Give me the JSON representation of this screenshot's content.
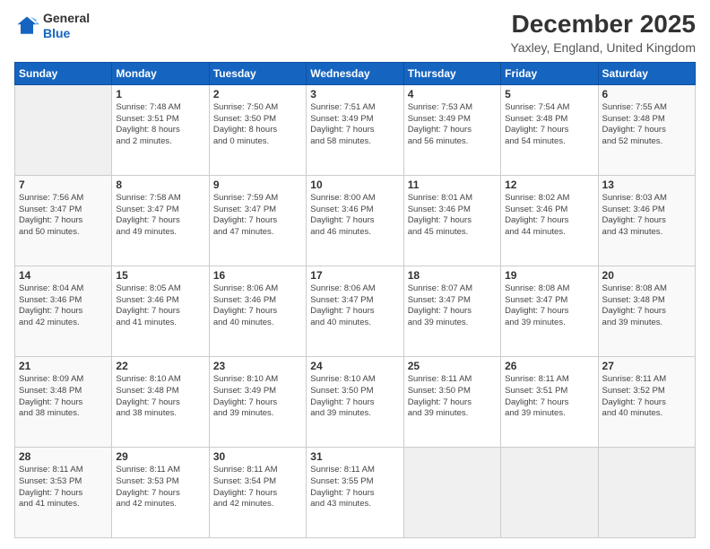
{
  "header": {
    "logo_line1": "General",
    "logo_line2": "Blue",
    "main_title": "December 2025",
    "subtitle": "Yaxley, England, United Kingdom"
  },
  "days_of_week": [
    "Sunday",
    "Monday",
    "Tuesday",
    "Wednesday",
    "Thursday",
    "Friday",
    "Saturday"
  ],
  "weeks": [
    [
      {
        "day": "",
        "info": ""
      },
      {
        "day": "1",
        "info": "Sunrise: 7:48 AM\nSunset: 3:51 PM\nDaylight: 8 hours\nand 2 minutes."
      },
      {
        "day": "2",
        "info": "Sunrise: 7:50 AM\nSunset: 3:50 PM\nDaylight: 8 hours\nand 0 minutes."
      },
      {
        "day": "3",
        "info": "Sunrise: 7:51 AM\nSunset: 3:49 PM\nDaylight: 7 hours\nand 58 minutes."
      },
      {
        "day": "4",
        "info": "Sunrise: 7:53 AM\nSunset: 3:49 PM\nDaylight: 7 hours\nand 56 minutes."
      },
      {
        "day": "5",
        "info": "Sunrise: 7:54 AM\nSunset: 3:48 PM\nDaylight: 7 hours\nand 54 minutes."
      },
      {
        "day": "6",
        "info": "Sunrise: 7:55 AM\nSunset: 3:48 PM\nDaylight: 7 hours\nand 52 minutes."
      }
    ],
    [
      {
        "day": "7",
        "info": "Sunrise: 7:56 AM\nSunset: 3:47 PM\nDaylight: 7 hours\nand 50 minutes."
      },
      {
        "day": "8",
        "info": "Sunrise: 7:58 AM\nSunset: 3:47 PM\nDaylight: 7 hours\nand 49 minutes."
      },
      {
        "day": "9",
        "info": "Sunrise: 7:59 AM\nSunset: 3:47 PM\nDaylight: 7 hours\nand 47 minutes."
      },
      {
        "day": "10",
        "info": "Sunrise: 8:00 AM\nSunset: 3:46 PM\nDaylight: 7 hours\nand 46 minutes."
      },
      {
        "day": "11",
        "info": "Sunrise: 8:01 AM\nSunset: 3:46 PM\nDaylight: 7 hours\nand 45 minutes."
      },
      {
        "day": "12",
        "info": "Sunrise: 8:02 AM\nSunset: 3:46 PM\nDaylight: 7 hours\nand 44 minutes."
      },
      {
        "day": "13",
        "info": "Sunrise: 8:03 AM\nSunset: 3:46 PM\nDaylight: 7 hours\nand 43 minutes."
      }
    ],
    [
      {
        "day": "14",
        "info": "Sunrise: 8:04 AM\nSunset: 3:46 PM\nDaylight: 7 hours\nand 42 minutes."
      },
      {
        "day": "15",
        "info": "Sunrise: 8:05 AM\nSunset: 3:46 PM\nDaylight: 7 hours\nand 41 minutes."
      },
      {
        "day": "16",
        "info": "Sunrise: 8:06 AM\nSunset: 3:46 PM\nDaylight: 7 hours\nand 40 minutes."
      },
      {
        "day": "17",
        "info": "Sunrise: 8:06 AM\nSunset: 3:47 PM\nDaylight: 7 hours\nand 40 minutes."
      },
      {
        "day": "18",
        "info": "Sunrise: 8:07 AM\nSunset: 3:47 PM\nDaylight: 7 hours\nand 39 minutes."
      },
      {
        "day": "19",
        "info": "Sunrise: 8:08 AM\nSunset: 3:47 PM\nDaylight: 7 hours\nand 39 minutes."
      },
      {
        "day": "20",
        "info": "Sunrise: 8:08 AM\nSunset: 3:48 PM\nDaylight: 7 hours\nand 39 minutes."
      }
    ],
    [
      {
        "day": "21",
        "info": "Sunrise: 8:09 AM\nSunset: 3:48 PM\nDaylight: 7 hours\nand 38 minutes."
      },
      {
        "day": "22",
        "info": "Sunrise: 8:10 AM\nSunset: 3:48 PM\nDaylight: 7 hours\nand 38 minutes."
      },
      {
        "day": "23",
        "info": "Sunrise: 8:10 AM\nSunset: 3:49 PM\nDaylight: 7 hours\nand 39 minutes."
      },
      {
        "day": "24",
        "info": "Sunrise: 8:10 AM\nSunset: 3:50 PM\nDaylight: 7 hours\nand 39 minutes."
      },
      {
        "day": "25",
        "info": "Sunrise: 8:11 AM\nSunset: 3:50 PM\nDaylight: 7 hours\nand 39 minutes."
      },
      {
        "day": "26",
        "info": "Sunrise: 8:11 AM\nSunset: 3:51 PM\nDaylight: 7 hours\nand 39 minutes."
      },
      {
        "day": "27",
        "info": "Sunrise: 8:11 AM\nSunset: 3:52 PM\nDaylight: 7 hours\nand 40 minutes."
      }
    ],
    [
      {
        "day": "28",
        "info": "Sunrise: 8:11 AM\nSunset: 3:53 PM\nDaylight: 7 hours\nand 41 minutes."
      },
      {
        "day": "29",
        "info": "Sunrise: 8:11 AM\nSunset: 3:53 PM\nDaylight: 7 hours\nand 42 minutes."
      },
      {
        "day": "30",
        "info": "Sunrise: 8:11 AM\nSunset: 3:54 PM\nDaylight: 7 hours\nand 42 minutes."
      },
      {
        "day": "31",
        "info": "Sunrise: 8:11 AM\nSunset: 3:55 PM\nDaylight: 7 hours\nand 43 minutes."
      },
      {
        "day": "",
        "info": ""
      },
      {
        "day": "",
        "info": ""
      },
      {
        "day": "",
        "info": ""
      }
    ]
  ]
}
